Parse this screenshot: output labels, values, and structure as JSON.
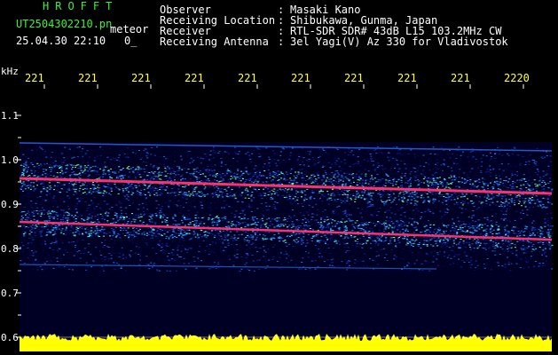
{
  "header": {
    "app_title": "HROFFT",
    "file_name": "UT2504302210.pn",
    "type_label": "meteor",
    "date_time": "25.04.30 22:10",
    "count": "0_"
  },
  "info": [
    {
      "label": "Observer",
      "value": "Masaki Kano"
    },
    {
      "label": "Receiving Location",
      "value": "Shibukawa, Gunma, Japan"
    },
    {
      "label": "Receiver",
      "value": "RTL-SDR SDR# 43dB L15 103.2MHz CW"
    },
    {
      "label": "Receiving Antenna",
      "value": "3el Yagi(V) Az 330 for Vladivostok"
    }
  ],
  "info_separator": ":",
  "axis": {
    "unit": "kHz",
    "y_ticks": [
      "1.1",
      "1.0",
      "0.9",
      "0.8",
      "0.7",
      "0.6"
    ],
    "x_ticks": [
      "221",
      "221",
      "221",
      "221",
      "221",
      "221",
      "221",
      "221",
      "221",
      "2220"
    ]
  },
  "colors": {
    "background": "#000000",
    "text_green": "#3cf03c",
    "text_white": "#ffffff",
    "axis_yellow": "#ffff3c",
    "power_bar": "#ffff00",
    "signal_red": "#ff3070"
  }
}
